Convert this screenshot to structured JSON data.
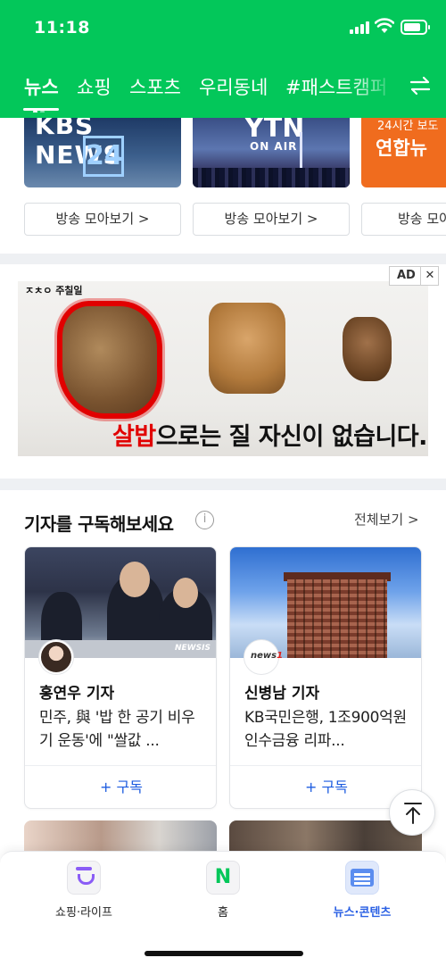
{
  "status_bar": {
    "time": "11:18"
  },
  "tabs": {
    "items": [
      {
        "label": "뉴스",
        "active": true
      },
      {
        "label": "쇼핑"
      },
      {
        "label": "스포츠"
      },
      {
        "label": "우리동네"
      },
      {
        "label": "#패스트캠퍼"
      }
    ],
    "swap_icon": "swap-arrows-icon"
  },
  "broadcast": {
    "channels": [
      {
        "logo_text": "KBS NEWS",
        "logo_number": "24",
        "button": "방송 모아보기 >"
      },
      {
        "logo_text": "YTN",
        "logo_sub": "ON AIR",
        "button": "방송 모아보기 >"
      },
      {
        "logo_top": "24시간 보도",
        "logo_text": "연합뉴",
        "button": "방송 모아보"
      }
    ]
  },
  "ad": {
    "badge": "AD",
    "close": "✕",
    "brand": "ㅈㅊㅇ 주칠일",
    "caption_highlight": "살밥",
    "caption_rest": "으로는 질 자신이 없습니다."
  },
  "reporters": {
    "title": "기자를 구독해보세요",
    "info_icon": "i",
    "see_all": "전체보기 >",
    "cards": [
      {
        "name": "홍연우 기자",
        "headline": "민주, 與 '밥 한 공기 비우기 운동'에 \"쌀값 ...",
        "subscribe": "+ 구독",
        "photo_watermark": "NEWSIS"
      },
      {
        "name": "신병남 기자",
        "headline": "KB국민은행, 1조900억원 인수금융 리파...",
        "subscribe": "+ 구독",
        "avatar_logo_a": "news",
        "avatar_logo_b": "1"
      }
    ]
  },
  "bottom_nav": {
    "items": [
      {
        "label": "쇼핑·라이프",
        "icon": "shopping-bag-icon"
      },
      {
        "label": "홈",
        "icon_text": "N"
      },
      {
        "label": "뉴스·콘텐츠",
        "icon": "news-card-icon",
        "active": true
      }
    ]
  },
  "colors": {
    "brand_green": "#03c75a",
    "accent_blue": "#1e5de0",
    "ad_red": "#e10000"
  }
}
